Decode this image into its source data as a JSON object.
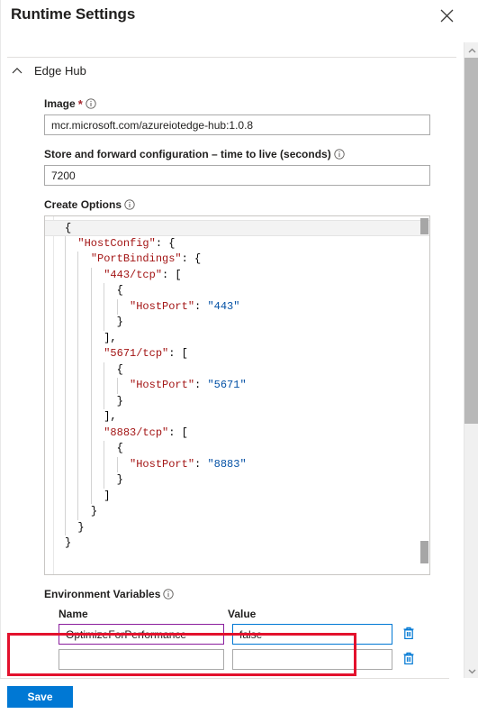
{
  "window": {
    "title": "Runtime Settings",
    "close_label": "Close",
    "close_icon": "close-icon"
  },
  "section": {
    "title": "Edge Hub",
    "chevron_icon": "chevron-up-icon",
    "expanded": true
  },
  "fields": {
    "image": {
      "label": "Image",
      "required_marker": "*",
      "info_icon": "info-icon",
      "value": "mcr.microsoft.com/azureiotedge-hub:1.0.8",
      "placeholder": ""
    },
    "ttl": {
      "label": "Store and forward configuration – time to live (seconds)",
      "info_icon": "info-icon",
      "value": "7200",
      "placeholder": ""
    },
    "create_options": {
      "label": "Create Options",
      "info_icon": "info-icon",
      "lines": [
        {
          "indent": 0,
          "tokens": [
            {
              "t": "p",
              "s": "{"
            }
          ]
        },
        {
          "indent": 1,
          "tokens": [
            {
              "t": "k",
              "s": "\"HostConfig\""
            },
            {
              "t": "p",
              "s": ": {"
            }
          ]
        },
        {
          "indent": 2,
          "tokens": [
            {
              "t": "k",
              "s": "\"PortBindings\""
            },
            {
              "t": "p",
              "s": ": {"
            }
          ]
        },
        {
          "indent": 3,
          "tokens": [
            {
              "t": "k",
              "s": "\"443/tcp\""
            },
            {
              "t": "p",
              "s": ": ["
            }
          ]
        },
        {
          "indent": 4,
          "tokens": [
            {
              "t": "p",
              "s": "{"
            }
          ]
        },
        {
          "indent": 5,
          "tokens": [
            {
              "t": "k",
              "s": "\"HostPort\""
            },
            {
              "t": "p",
              "s": ": "
            },
            {
              "t": "v",
              "s": "\"443\""
            }
          ]
        },
        {
          "indent": 4,
          "tokens": [
            {
              "t": "p",
              "s": "}"
            }
          ]
        },
        {
          "indent": 3,
          "tokens": [
            {
              "t": "p",
              "s": "],"
            }
          ]
        },
        {
          "indent": 3,
          "tokens": [
            {
              "t": "k",
              "s": "\"5671/tcp\""
            },
            {
              "t": "p",
              "s": ": ["
            }
          ]
        },
        {
          "indent": 4,
          "tokens": [
            {
              "t": "p",
              "s": "{"
            }
          ]
        },
        {
          "indent": 5,
          "tokens": [
            {
              "t": "k",
              "s": "\"HostPort\""
            },
            {
              "t": "p",
              "s": ": "
            },
            {
              "t": "v",
              "s": "\"5671\""
            }
          ]
        },
        {
          "indent": 4,
          "tokens": [
            {
              "t": "p",
              "s": "}"
            }
          ]
        },
        {
          "indent": 3,
          "tokens": [
            {
              "t": "p",
              "s": "],"
            }
          ]
        },
        {
          "indent": 3,
          "tokens": [
            {
              "t": "k",
              "s": "\"8883/tcp\""
            },
            {
              "t": "p",
              "s": ": ["
            }
          ]
        },
        {
          "indent": 4,
          "tokens": [
            {
              "t": "p",
              "s": "{"
            }
          ]
        },
        {
          "indent": 5,
          "tokens": [
            {
              "t": "k",
              "s": "\"HostPort\""
            },
            {
              "t": "p",
              "s": ": "
            },
            {
              "t": "v",
              "s": "\"8883\""
            }
          ]
        },
        {
          "indent": 4,
          "tokens": [
            {
              "t": "p",
              "s": "}"
            }
          ]
        },
        {
          "indent": 3,
          "tokens": [
            {
              "t": "p",
              "s": "]"
            }
          ]
        },
        {
          "indent": 2,
          "tokens": [
            {
              "t": "p",
              "s": "}"
            }
          ]
        },
        {
          "indent": 1,
          "tokens": [
            {
              "t": "p",
              "s": "}"
            }
          ]
        },
        {
          "indent": 0,
          "tokens": [
            {
              "t": "p",
              "s": "}"
            }
          ]
        }
      ]
    }
  },
  "env_vars": {
    "label": "Environment Variables",
    "info_icon": "info-icon",
    "columns": {
      "name": "Name",
      "value": "Value"
    },
    "rows": [
      {
        "name": "OptimizeForPerformance",
        "value": "false",
        "name_placeholder": "",
        "value_placeholder": "",
        "delete_icon": "trash-icon",
        "highlighted": true
      },
      {
        "name": "",
        "value": "",
        "name_placeholder": "",
        "value_placeholder": "",
        "delete_icon": "trash-icon",
        "highlighted": false
      }
    ]
  },
  "footer": {
    "save_label": "Save"
  },
  "scrollbar": {
    "up_icon": "chevron-up-icon",
    "down_icon": "chevron-down-icon"
  },
  "colors": {
    "accent": "#0078d4",
    "annotation": "#e3112d",
    "focus_name": "#8b1f9e",
    "focus_value": "#0078d4",
    "json_key": "#a31515",
    "json_value": "#0451a5",
    "required": "#a4262c"
  }
}
